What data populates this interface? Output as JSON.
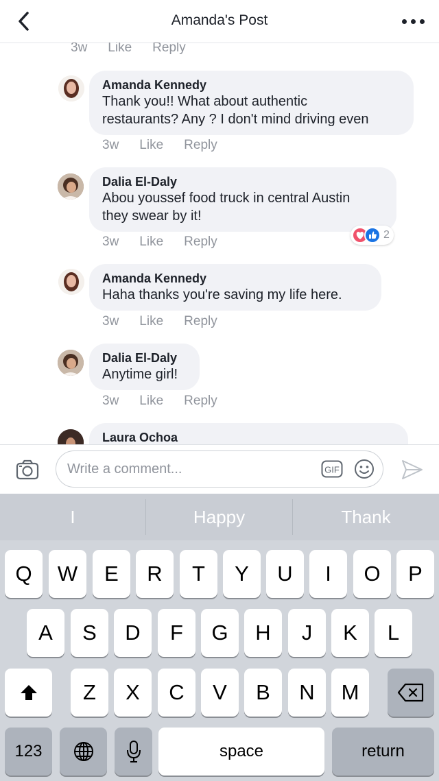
{
  "header": {
    "title": "Amanda's Post"
  },
  "first_meta": {
    "time": "3w",
    "like": "Like",
    "reply": "Reply"
  },
  "comments": [
    {
      "author": "Amanda Kennedy",
      "text_line1": "Thank you!! What about authentic",
      "text_line2": "restaurants? Any ? I don't mind driving even",
      "time": "3w",
      "like": "Like",
      "reply": "Reply"
    },
    {
      "author": "Dalia El-Daly",
      "text_line1": "Abou youssef food truck in central Austin",
      "text_line2": "they swear by it!",
      "time": "3w",
      "like": "Like",
      "reply": "Reply",
      "reaction_count": "2"
    },
    {
      "author": "Amanda Kennedy",
      "text_line1": "Haha thanks you're saving my life here.",
      "time": "3w",
      "like": "Like",
      "reply": "Reply"
    },
    {
      "author": "Dalia El-Daly",
      "text_line1": "Anytime girl!",
      "time": "3w",
      "like": "Like",
      "reply": "Reply"
    },
    {
      "author": "Laura Ochoa"
    }
  ],
  "composer": {
    "placeholder": "Write a comment...",
    "gif_label": "GIF"
  },
  "keyboard": {
    "suggestions": [
      "I",
      "Happy",
      "Thank"
    ],
    "row1": [
      "Q",
      "W",
      "E",
      "R",
      "T",
      "Y",
      "U",
      "I",
      "O",
      "P"
    ],
    "row2": [
      "A",
      "S",
      "D",
      "F",
      "G",
      "H",
      "J",
      "K",
      "L"
    ],
    "row3": [
      "Z",
      "X",
      "C",
      "V",
      "B",
      "N",
      "M"
    ],
    "numbers_label": "123",
    "space_label": "space",
    "return_label": "return"
  },
  "colors": {
    "accent": "#1b74e4",
    "love": "#f0526b",
    "bubble": "#f1f2f6",
    "meta_text": "#90949c"
  },
  "icons": [
    "back-icon",
    "more-icon",
    "camera-icon",
    "gif-icon",
    "emoji-icon",
    "send-icon",
    "shift-icon",
    "globe-icon",
    "microphone-icon",
    "backspace-icon"
  ]
}
